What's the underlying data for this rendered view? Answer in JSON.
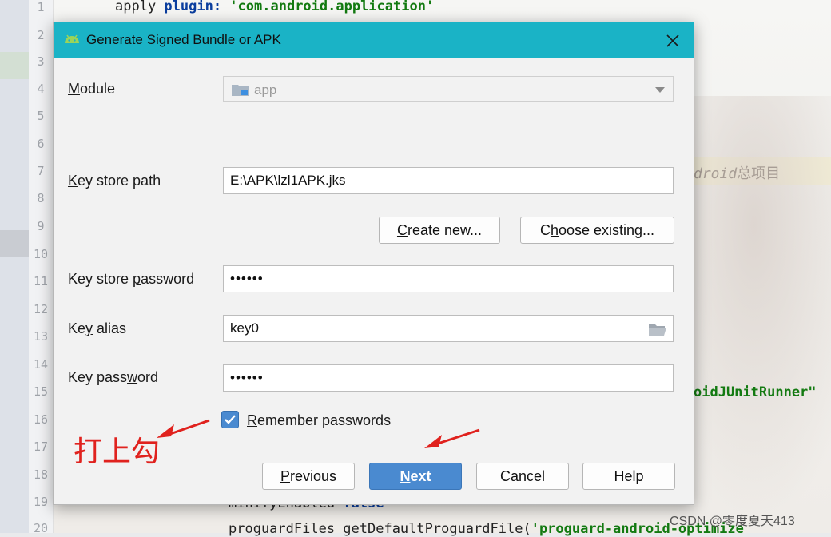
{
  "editor": {
    "line_numbers": [
      "1",
      "2",
      "3",
      "4",
      "5",
      "6",
      "7",
      "8",
      "9",
      "10",
      "11",
      "12",
      "13",
      "14",
      "15",
      "16",
      "17",
      "18",
      "19",
      "20"
    ],
    "code_line1": {
      "plain": "apply ",
      "keyword": "plugin:",
      "string": " 'com.android.application'"
    },
    "code_line19": {
      "plain": "minifyEnabled ",
      "keyword": "false"
    },
    "code_line20": {
      "plain": "proguardFiles getDefaultProguardFile(",
      "string": "'proguard-android-optimize"
    },
    "right_note_italic": "droid",
    "right_note_cjk": "总项目",
    "right_runner": "oidJUnitRunner\""
  },
  "dialog": {
    "title": "Generate Signed Bundle or APK",
    "module": {
      "label_prefix": "",
      "label_accel": "M",
      "label_rest": "odule",
      "value": "app"
    },
    "key_store_path": {
      "label_accel": "K",
      "label_rest": "ey store path",
      "value": "E:\\APK\\lzl1APK.jks"
    },
    "create_new": {
      "accel": "C",
      "rest": "reate new..."
    },
    "choose_existing": {
      "pre": "C",
      "accel": "h",
      "rest": "oose existing..."
    },
    "key_store_password": {
      "label_pre": "Key store ",
      "label_accel": "p",
      "label_rest": "assword",
      "value": "••••••"
    },
    "key_alias": {
      "label_pre": "Ke",
      "label_accel": "y",
      "label_rest": " alias",
      "value": "key0"
    },
    "key_password": {
      "label_pre": "Key pass",
      "label_accel": "w",
      "label_rest": "ord",
      "value": "••••••"
    },
    "remember": {
      "accel": "R",
      "rest": "emember passwords",
      "checked": true
    },
    "buttons": {
      "previous": {
        "accel": "P",
        "rest": "revious"
      },
      "next": {
        "accel": "N",
        "rest": "ext"
      },
      "cancel": "Cancel",
      "help": "Help"
    }
  },
  "annotation": {
    "text": "打上勾",
    "color": "#e0221e"
  },
  "watermark": "CSDN @零度夏天413",
  "colors": {
    "titlebar": "#1ab3c6",
    "primary_button": "#4a8ad0",
    "checkbox": "#4a8ad0"
  }
}
